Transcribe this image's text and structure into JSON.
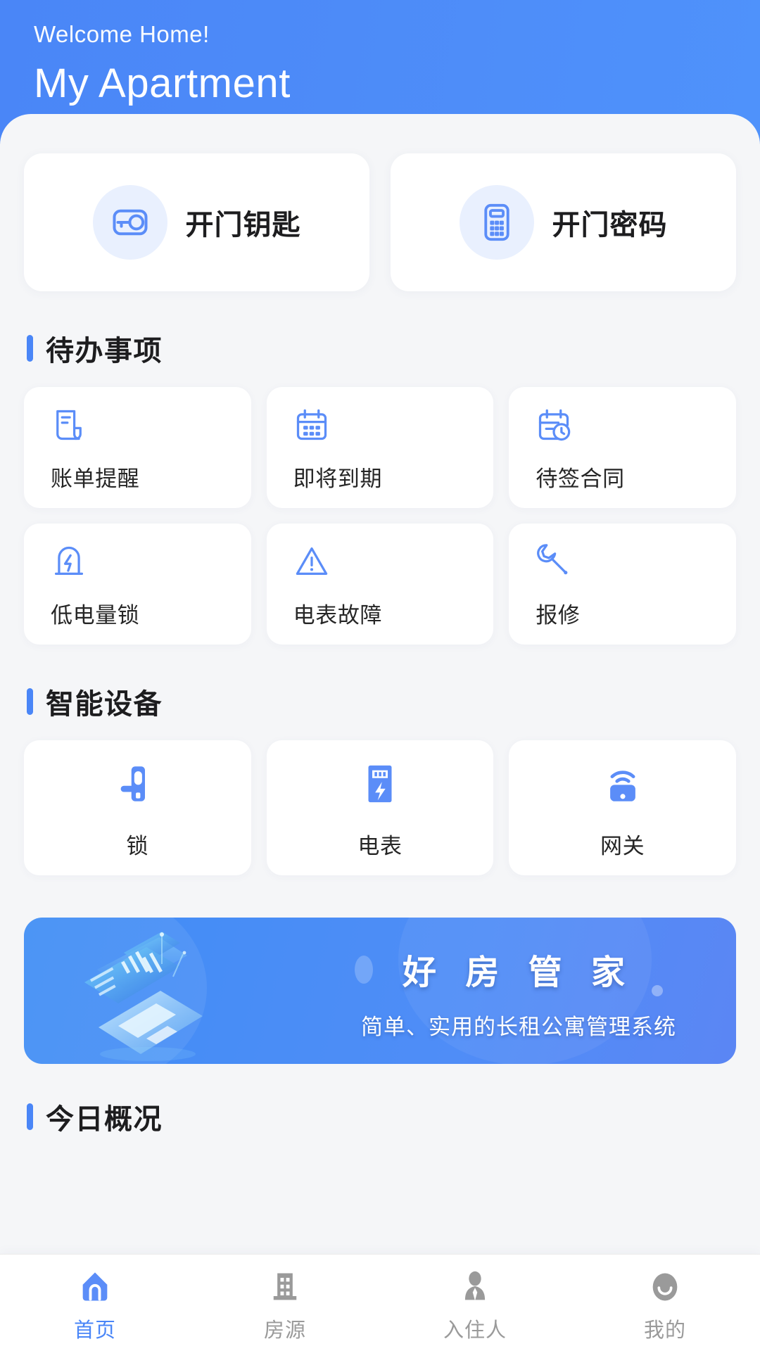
{
  "header": {
    "welcome": "Welcome Home!",
    "title": "My Apartment"
  },
  "quick_actions": [
    {
      "label": "开门钥匙",
      "icon": "door-key-icon"
    },
    {
      "label": "开门密码",
      "icon": "keypad-password-icon"
    }
  ],
  "sections": {
    "todo": {
      "title": "待办事项",
      "items": [
        {
          "label": "账单提醒",
          "icon": "bill-document-icon"
        },
        {
          "label": "即将到期",
          "icon": "calendar-icon"
        },
        {
          "label": "待签合同",
          "icon": "calendar-clock-icon"
        },
        {
          "label": "低电量锁",
          "icon": "low-battery-lock-icon"
        },
        {
          "label": "电表故障",
          "icon": "warning-triangle-icon"
        },
        {
          "label": "报修",
          "icon": "wrench-icon"
        }
      ]
    },
    "devices": {
      "title": "智能设备",
      "items": [
        {
          "label": "锁",
          "icon": "smart-lock-icon"
        },
        {
          "label": "电表",
          "icon": "electric-meter-icon"
        },
        {
          "label": "网关",
          "icon": "gateway-wifi-icon"
        }
      ]
    },
    "overview": {
      "title": "今日概况"
    }
  },
  "banner": {
    "title": "好 房 管 家",
    "subtitle": "简单、实用的长租公寓管理系统"
  },
  "tabbar": [
    {
      "label": "首页",
      "icon": "home-icon",
      "active": true
    },
    {
      "label": "房源",
      "icon": "building-icon",
      "active": false
    },
    {
      "label": "入住人",
      "icon": "tenant-person-icon",
      "active": false
    },
    {
      "label": "我的",
      "icon": "profile-avatar-icon",
      "active": false
    }
  ],
  "colors": {
    "accent": "#4a86f7",
    "header_gradient_start": "#4a86f7",
    "header_gradient_end": "#4f92fb",
    "page_bg": "#f5f6f8",
    "card_bg": "#ffffff",
    "icon_tint_bg": "#e9f0fe",
    "text_primary": "#1d1d1f",
    "text_secondary": "#262626",
    "tab_inactive": "#9a9a9a"
  }
}
